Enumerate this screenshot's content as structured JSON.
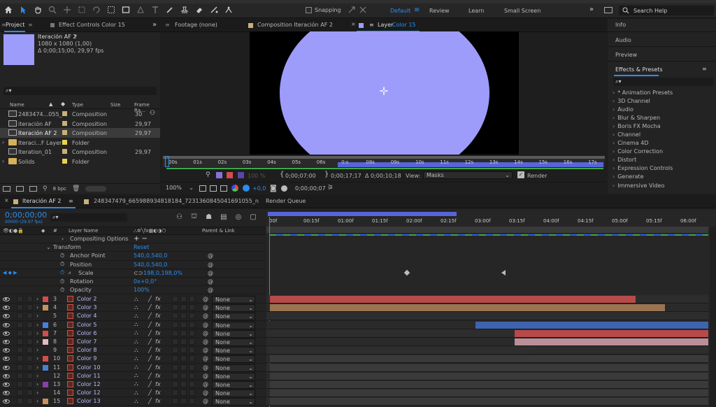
{
  "toolbar": {
    "snapping_label": "Snapping",
    "workspaces": [
      "Default",
      "Review",
      "Learn",
      "Small Screen"
    ],
    "search_placeholder": "Search Help"
  },
  "project_panel": {
    "tabs": [
      "Project",
      "Effect Controls Color 15"
    ],
    "preview_name": "Iteración AF 2",
    "preview_info_1": "1080 x 1080 (1,00)",
    "preview_info_2": "Δ 0;00;15;00, 29,97 fps",
    "columns": [
      "Name",
      "Type",
      "Size",
      "Frame Ra..."
    ],
    "items": [
      {
        "name": "2483474...055_n",
        "type": "Composition",
        "rate": "30",
        "color": "#c8b07a",
        "kind": "comp"
      },
      {
        "name": "iteración AF",
        "type": "Composition",
        "rate": "29,97",
        "color": "#c8b07a",
        "kind": "comp"
      },
      {
        "name": "Iteración AF 2",
        "type": "Composition",
        "rate": "29,97",
        "color": "#c8b07a",
        "kind": "comp"
      },
      {
        "name": "Iteraci...F Layers",
        "type": "Folder",
        "rate": "",
        "color": "#e8d34a",
        "kind": "folder"
      },
      {
        "name": "Iteration_01",
        "type": "Composition",
        "rate": "29,97",
        "color": "#c8b07a",
        "kind": "comp"
      },
      {
        "name": "Solids",
        "type": "Folder",
        "rate": "",
        "color": "#e8d34a",
        "kind": "folder"
      }
    ],
    "bpc": "8 bpc"
  },
  "viewer": {
    "tabs": [
      "Footage (none)",
      "Composition Iteración AF 2",
      "Layer",
      "Color 15"
    ],
    "ruler_labels": [
      "00s",
      "01s",
      "02s",
      "03s",
      "04s",
      "05s",
      "06s",
      "0:s",
      "08s",
      "09s",
      "10s",
      "11s",
      "12s",
      "13s",
      "14s",
      "15s",
      "16s",
      "17s"
    ],
    "circle_color": "#9e9cfa",
    "mid_pct": "100 %",
    "in_time": "0;00;07;00",
    "out_time": "0;00;17;17",
    "duration": "Δ 0;00;10;18",
    "view_label": "View:",
    "view_value": "Masks",
    "render_label": "Render",
    "zoom": "100%",
    "exposure": "+0,0",
    "current_time": "0;00;00;07"
  },
  "right_panel": {
    "sections": [
      "Info",
      "Audio",
      "Preview",
      "Effects & Presets"
    ],
    "effects": [
      "* Animation Presets",
      "3D Channel",
      "Audio",
      "Blur & Sharpen",
      "Boris FX Mocha",
      "Channel",
      "Cinema 4D",
      "Color Correction",
      "Distort",
      "Expression Controls",
      "Generate",
      "Immersive Video"
    ]
  },
  "timeline": {
    "tabs": [
      "Iteración AF 2",
      "248347479_665988934818184_7231360845041691055_n",
      "Render Queue"
    ],
    "timecode": "0;00;00;00",
    "fps": "00000 (29.97 fps)",
    "col_layer_name": "Layer Name",
    "col_parent": "Parent & Link",
    "ruler": [
      "00f",
      "00:15f",
      "01:00f",
      "01:15f",
      "02:00f",
      "02:15f",
      "03:00f",
      "03:15f",
      "04:00f",
      "04:15f",
      "05:00f",
      "05:15f",
      "06:00f"
    ],
    "props": [
      {
        "name": "Compositing Options",
        "value": "+ −",
        "indent": 1,
        "group": false
      },
      {
        "name": "Transform",
        "value": "Reset",
        "indent": 0,
        "group": true
      },
      {
        "name": "Anchor Point",
        "value": "540,0,540,0",
        "indent": 2,
        "group": false
      },
      {
        "name": "Position",
        "value": "540,0,540,0",
        "indent": 2,
        "group": false
      },
      {
        "name": "Scale",
        "value": "198,0,198,0%",
        "indent": 2,
        "group": false
      },
      {
        "name": "Rotation",
        "value": "0x+0,0°",
        "indent": 2,
        "group": false
      },
      {
        "name": "Opacity",
        "value": "100%",
        "indent": 2,
        "group": false
      }
    ],
    "layers": [
      {
        "num": "3",
        "name": "Color 2",
        "label": "#d44c4c",
        "parent": "None"
      },
      {
        "num": "4",
        "name": "Color 3",
        "label": "#c7935a",
        "parent": "None"
      },
      {
        "num": "5",
        "name": "Color 4",
        "label": "#222222",
        "parent": "None"
      },
      {
        "num": "6",
        "name": "Color 5",
        "label": "#4a7fd8",
        "parent": "None"
      },
      {
        "num": "7",
        "name": "Color 6",
        "label": "#d44c4c",
        "parent": "None"
      },
      {
        "num": "8",
        "name": "Color 7",
        "label": "#e0bcc0",
        "parent": "None"
      },
      {
        "num": "9",
        "name": "Color 8",
        "label": "#222222",
        "parent": "None"
      },
      {
        "num": "10",
        "name": "Color 9",
        "label": "#d44c4c",
        "parent": "None"
      },
      {
        "num": "11",
        "name": "Color 10",
        "label": "#4a7fd8",
        "parent": "None"
      },
      {
        "num": "12",
        "name": "Color 11",
        "label": "#222222",
        "parent": "None"
      },
      {
        "num": "13",
        "name": "Color 12",
        "label": "#8a3fa8",
        "parent": "None"
      },
      {
        "num": "14",
        "name": "Color 12",
        "label": "#222222",
        "parent": "None"
      },
      {
        "num": "15",
        "name": "Color 13",
        "label": "#c7935a",
        "parent": "None"
      }
    ]
  }
}
